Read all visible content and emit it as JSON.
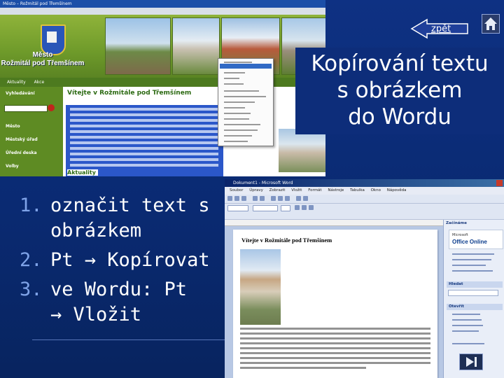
{
  "slide": {
    "title_lines": [
      "Kopírování textu",
      "s obrázkem",
      "do Wordu"
    ],
    "back_label": "zpět",
    "steps": [
      {
        "num": "1.",
        "lines": [
          "označit text s",
          "obrázkem"
        ]
      },
      {
        "num": "2.",
        "lines": [
          "Pt → Kopírovat"
        ]
      },
      {
        "num": "3.",
        "lines": [
          "ve Wordu: Pt",
          "→ Vložit"
        ]
      }
    ]
  },
  "website": {
    "window_title": "Město – Rožmitál pod Třemšínem",
    "town_line1": "Město",
    "town_line2": "Rožmitál pod Třemšínem",
    "nav": [
      "Aktuality",
      "Akce"
    ],
    "sidebar": [
      "Vyhledávání",
      "Město",
      "Městský úřad",
      "Úřední deska",
      "Volby"
    ],
    "heading": "Vítejte v Rožmitále pod Třemšínem",
    "section": "Aktuality"
  },
  "word": {
    "window_title": "Dokument1 - Microsoft Word",
    "menu": [
      "Soubor",
      "Úpravy",
      "Zobrazit",
      "Vložit",
      "Formát",
      "Nástroje",
      "Tabulka",
      "Okno",
      "Nápověda"
    ],
    "doc_heading": "Vítejte v Rožmitále pod Třemšínem",
    "pane_title": "Začínáme",
    "pane_logo_small": "Microsoft",
    "pane_logo": "Office Online",
    "pane_section_open": "Otevřít",
    "pane_section_search": "Hledat"
  },
  "colors": {
    "slide_bg": "#0d2d7a",
    "step_numbers": "#7fa3e8",
    "text": "#ffffff"
  }
}
